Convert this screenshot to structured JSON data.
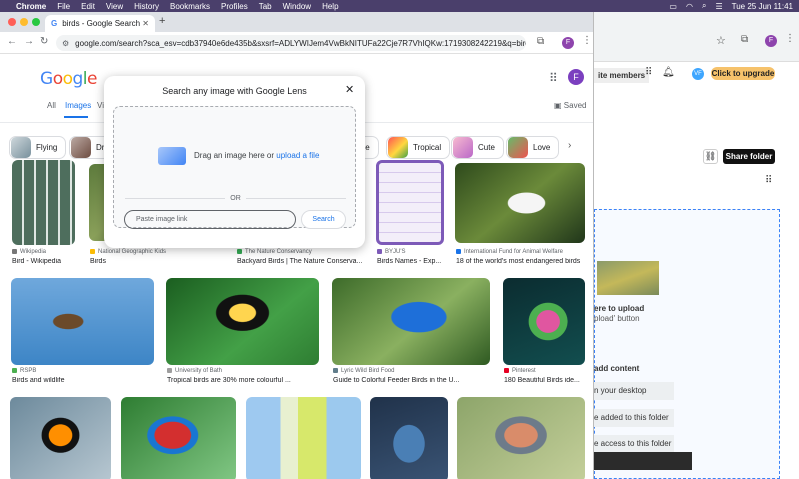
{
  "menubar": {
    "items": [
      "Chrome",
      "File",
      "Edit",
      "View",
      "History",
      "Bookmarks",
      "Profiles",
      "Tab",
      "Window",
      "Help"
    ],
    "datetime": "Tue 25 Jun  11:41"
  },
  "tab": {
    "title": "birds - Google Search"
  },
  "omnibox": {
    "url": "google.com/search?sca_esv=cdb37940e6de435b&sxsrf=ADLYWIJem4VwBkNITUFa22Cje7R7VhIQKw:1719308242219&q=birds&udm=..."
  },
  "profile_initial": "F",
  "google": {
    "nav_tabs": [
      "All",
      "Images",
      "Vi"
    ],
    "saved_label": "Saved",
    "chips": [
      "Flying",
      "Dr",
      "lue",
      "Tropical",
      "Cute",
      "Love"
    ]
  },
  "lens": {
    "title": "Search any image with Google Lens",
    "drag_text": "Drag an image here or ",
    "upload_link": "upload a file",
    "or_label": "OR",
    "paste_placeholder": "Paste image link",
    "search_button": "Search"
  },
  "results": {
    "row1": [
      {
        "source": "Wikipedia",
        "title": "Bird - Wikipedia"
      },
      {
        "source": "National Geographic Kids",
        "title": "Birds"
      },
      {
        "source": "The Nature Conservancy",
        "title": "Backyard Birds | The Nature Conserva..."
      },
      {
        "source": "BYJU'S",
        "title": "Birds Names - Exp..."
      },
      {
        "source": "International Fund for Animal Welfare",
        "title": "18 of the world's most endangered birds"
      }
    ],
    "row2": [
      {
        "source": "RSPB",
        "title": "Birds and wildlife"
      },
      {
        "source": "University of Bath",
        "title": "Tropical birds are 30% more colourful ..."
      },
      {
        "source": "Lyric Wild Bird Food",
        "title": "Guide to Colorful Feeder Birds in the U..."
      },
      {
        "source": "Pinterest",
        "title": "180 Beautiful Birds ide..."
      }
    ]
  },
  "back_window": {
    "members_label": "ite members",
    "vf_initials": "VF",
    "upgrade_button": "Click to upgrade",
    "share_button": "Share folder",
    "upload_title": "ere to upload",
    "upload_sub": "pload' button",
    "add_content": "add content",
    "options": [
      "n your desktop",
      "e added to this folder",
      "e access to this folder"
    ]
  },
  "colors": {
    "google_blue": "#4285f4",
    "google_red": "#ea4335",
    "google_yellow": "#fbbc05",
    "google_green": "#34a853",
    "upgrade": "#f6c26b"
  }
}
